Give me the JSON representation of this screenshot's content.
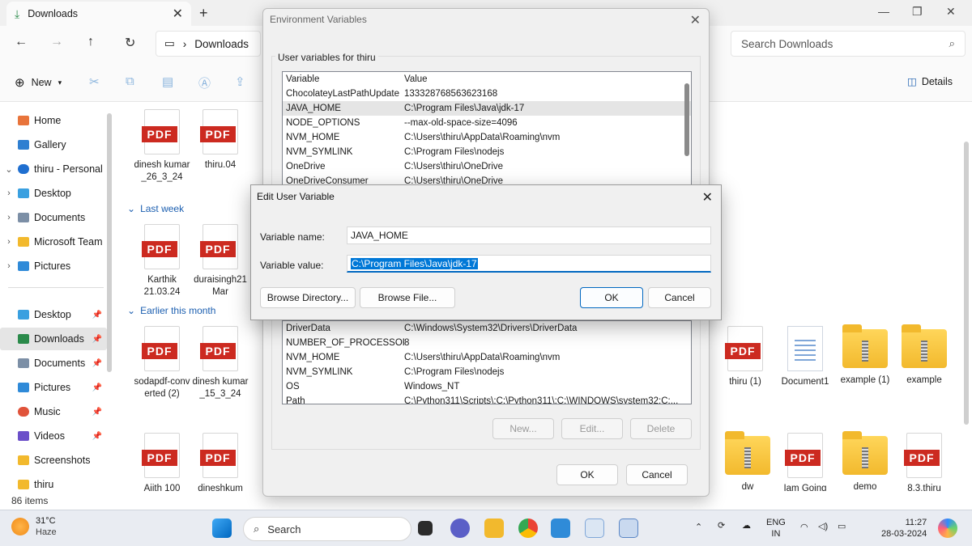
{
  "explorer": {
    "tab_title": "Downloads",
    "address": "Downloads",
    "search_placeholder": "Search Downloads",
    "new_label": "New",
    "details_label": "Details",
    "status": "86 items",
    "sidebar": {
      "items": [
        {
          "label": "Home"
        },
        {
          "label": "Gallery"
        },
        {
          "label": "thiru - Personal"
        },
        {
          "label": "Desktop"
        },
        {
          "label": "Documents"
        },
        {
          "label": "Microsoft Team"
        },
        {
          "label": "Pictures"
        },
        {
          "label": "Desktop"
        },
        {
          "label": "Downloads"
        },
        {
          "label": "Documents"
        },
        {
          "label": "Pictures"
        },
        {
          "label": "Music"
        },
        {
          "label": "Videos"
        },
        {
          "label": "Screenshots"
        },
        {
          "label": "thiru"
        }
      ]
    },
    "groups": [
      "Last week",
      "Earlier this month"
    ],
    "files": [
      {
        "name": "dinesh kumar _26_3_24",
        "kind": "pdf"
      },
      {
        "name": "thiru.04",
        "kind": "pdf"
      },
      {
        "name": "Karthik 21.03.24",
        "kind": "pdf"
      },
      {
        "name": "duraisingh21Mar",
        "kind": "pdf"
      },
      {
        "name": "sodapdf-converted (2)",
        "kind": "pdf"
      },
      {
        "name": "dinesh kumar _15_3_24",
        "kind": "pdf"
      },
      {
        "name": "Ajith 100",
        "kind": "pdf"
      },
      {
        "name": "dineshkum",
        "kind": "pdf"
      },
      {
        "name": "thiru (1)",
        "kind": "pdf"
      },
      {
        "name": "Document1",
        "kind": "doc"
      },
      {
        "name": "example (1)",
        "kind": "zip"
      },
      {
        "name": "example",
        "kind": "zip"
      },
      {
        "name": "dw",
        "kind": "zip"
      },
      {
        "name": "Iam Going",
        "kind": "pdf"
      },
      {
        "name": "demo",
        "kind": "zip"
      },
      {
        "name": "8.3.thiru",
        "kind": "pdf"
      }
    ],
    "pdf_badge": "PDF"
  },
  "env_dialog": {
    "title": "Environment Variables",
    "user_group_label": "User variables for thiru",
    "col_variable": "Variable",
    "col_value": "Value",
    "user_vars": [
      {
        "name": "ChocolateyLastPathUpdate",
        "value": "133328768563623168"
      },
      {
        "name": "JAVA_HOME",
        "value": "C:\\Program Files\\Java\\jdk-17"
      },
      {
        "name": "NODE_OPTIONS",
        "value": "--max-old-space-size=4096"
      },
      {
        "name": "NVM_HOME",
        "value": "C:\\Users\\thiru\\AppData\\Roaming\\nvm"
      },
      {
        "name": "NVM_SYMLINK",
        "value": "C:\\Program Files\\nodejs"
      },
      {
        "name": "OneDrive",
        "value": "C:\\Users\\thiru\\OneDrive"
      },
      {
        "name": "OneDriveConsumer",
        "value": "C:\\Users\\thiru\\OneDrive"
      }
    ],
    "system_vars": [
      {
        "name": "DriverData",
        "value": "C:\\Windows\\System32\\Drivers\\DriverData"
      },
      {
        "name": "NUMBER_OF_PROCESSORS",
        "value": "8"
      },
      {
        "name": "NVM_HOME",
        "value": "C:\\Users\\thiru\\AppData\\Roaming\\nvm"
      },
      {
        "name": "NVM_SYMLINK",
        "value": "C:\\Program Files\\nodejs"
      },
      {
        "name": "OS",
        "value": "Windows_NT"
      },
      {
        "name": "Path",
        "value": "C:\\Python311\\Scripts\\;C:\\Python311\\;C:\\WINDOWS\\system32;C:..."
      }
    ],
    "sys_new": "New...",
    "sys_edit": "Edit...",
    "sys_delete": "Delete",
    "ok": "OK",
    "cancel": "Cancel"
  },
  "edit_dialog": {
    "title": "Edit User Variable",
    "name_label": "Variable name:",
    "name_value": "JAVA_HOME",
    "value_label": "Variable value:",
    "value_value": "C:\\Program Files\\Java\\jdk-17",
    "browse_dir": "Browse Directory...",
    "browse_file": "Browse File...",
    "ok": "OK",
    "cancel": "Cancel"
  },
  "taskbar": {
    "temp": "31°C",
    "weather": "Haze",
    "search": "Search",
    "lang1": "ENG",
    "lang2": "IN",
    "time": "11:27",
    "date": "28-03-2024"
  }
}
